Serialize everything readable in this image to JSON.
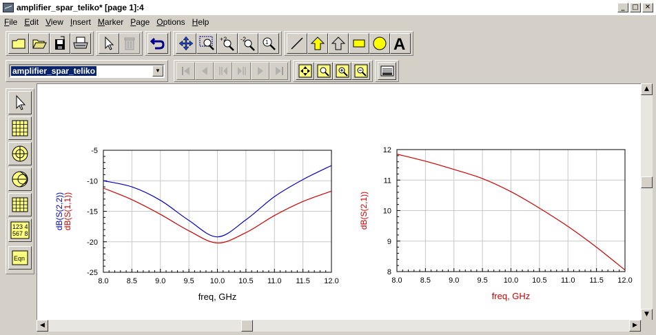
{
  "window": {
    "title": "amplifier_spar_teliko* [page 1]:4",
    "controls": {
      "minimize": "_",
      "maximize": "□",
      "close": "✕"
    }
  },
  "menu": [
    "File",
    "Edit",
    "View",
    "Insert",
    "Marker",
    "Page",
    "Options",
    "Help"
  ],
  "toolbar_main": [
    "open-new-icon",
    "open-folder-icon",
    "save-icon",
    "print-icon",
    "select-pointer-icon",
    "delete-icon",
    "undo-icon",
    "move-icon",
    "zoom-area-icon",
    "zoom-in-icon",
    "zoom-out-icon",
    "zoom-100-icon",
    "line-icon",
    "polyline-icon",
    "polygon-icon",
    "rectangle-icon",
    "circle-icon",
    "text-icon"
  ],
  "dataset_select": {
    "value": "amplifier_spar_teliko"
  },
  "toolbar_nav": [
    "first-page-icon",
    "prev-icon",
    "prev-fast-icon",
    "next-fast-icon",
    "next-icon",
    "last-page-icon",
    "zoom-fit-icon",
    "zoom-in-icon",
    "zoom-region-icon",
    "zoom-out-icon",
    "datafile-icon"
  ],
  "palette": [
    "pointer-icon",
    "rectangular-plot-icon",
    "polar-plot-icon",
    "smith-chart-icon",
    "list-table-icon",
    "stack-numbers-icon",
    "equation-icon"
  ],
  "palette_labels": {
    "numbers_line1": "123 4",
    "numbers_line2": "567 8",
    "eqn": "Eqn"
  },
  "chart_data": [
    {
      "type": "line",
      "xlabel": "freq, GHz",
      "ylabel_series": [
        "dB(S(2,2))",
        "dB(S(1,1))"
      ],
      "xlim": [
        8.0,
        12.0
      ],
      "ylim": [
        -25,
        -5
      ],
      "x_ticks": [
        "8.0",
        "8.5",
        "9.0",
        "9.5",
        "10.0",
        "10.5",
        "11.0",
        "11.5",
        "12.0"
      ],
      "y_ticks": [
        "-5",
        "-10",
        "-15",
        "-20",
        "-25"
      ],
      "grid": true,
      "x": [
        8.0,
        8.5,
        9.0,
        9.5,
        10.0,
        10.5,
        11.0,
        11.5,
        12.0
      ],
      "series": [
        {
          "name": "dB(S(2,2))",
          "color": "#0000c0",
          "values": [
            -10.0,
            -11.0,
            -13.2,
            -16.5,
            -19.2,
            -16.4,
            -12.6,
            -9.8,
            -7.5
          ]
        },
        {
          "name": "dB(S(1,1))",
          "color": "#cc0000",
          "values": [
            -11.2,
            -13.1,
            -15.5,
            -18.2,
            -20.2,
            -18.5,
            -15.7,
            -13.4,
            -11.7
          ]
        }
      ]
    },
    {
      "type": "line",
      "xlabel": "freq, GHz",
      "ylabel_series": [
        "dB(S(2,1))"
      ],
      "xlim": [
        8.0,
        12.0
      ],
      "ylim": [
        8,
        12
      ],
      "x_ticks": [
        "8.0",
        "8.5",
        "9.0",
        "9.5",
        "10.0",
        "10.5",
        "11.0",
        "11.5",
        "12.0"
      ],
      "y_ticks": [
        "12",
        "11",
        "10",
        "9",
        "8"
      ],
      "grid": true,
      "x": [
        8.0,
        8.5,
        9.0,
        9.5,
        10.0,
        10.5,
        11.0,
        11.5,
        12.0
      ],
      "series": [
        {
          "name": "dB(S(2,1))",
          "color": "#cc0000",
          "values": [
            11.85,
            11.62,
            11.35,
            11.05,
            10.62,
            10.08,
            9.48,
            8.8,
            8.05
          ]
        }
      ]
    }
  ]
}
